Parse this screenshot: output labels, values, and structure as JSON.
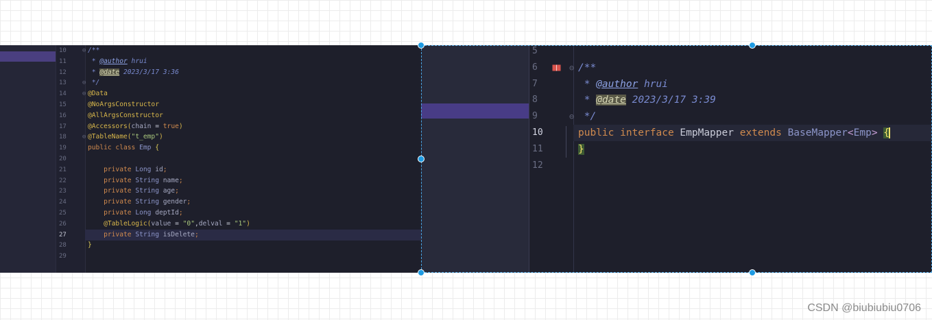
{
  "left_editor": {
    "lines": [
      {
        "n": "10",
        "fold": "⊖",
        "tokens": [
          {
            "c": "cm",
            "t": "/**"
          }
        ]
      },
      {
        "n": "11",
        "tokens": [
          {
            "c": "cm",
            "t": " * "
          },
          {
            "c": "tag",
            "t": "@author"
          },
          {
            "c": "cm",
            "t": " hrui"
          }
        ]
      },
      {
        "n": "12",
        "tokens": [
          {
            "c": "cm",
            "t": " * "
          },
          {
            "c": "tagbox",
            "t": "@date"
          },
          {
            "c": "cm",
            "t": " 2023/3/17 3:36"
          }
        ]
      },
      {
        "n": "13",
        "fold": "⊖",
        "tokens": [
          {
            "c": "cm",
            "t": " */"
          }
        ]
      },
      {
        "n": "14",
        "fold": "⊖",
        "tokens": [
          {
            "c": "ann",
            "t": "@Data"
          }
        ]
      },
      {
        "n": "15",
        "tokens": [
          {
            "c": "ann",
            "t": "@NoArgsConstructor"
          }
        ]
      },
      {
        "n": "16",
        "tokens": [
          {
            "c": "ann",
            "t": "@AllArgsConstructor"
          }
        ]
      },
      {
        "n": "17",
        "tokens": [
          {
            "c": "ann",
            "t": "@Accessors("
          },
          {
            "c": "id",
            "t": "chain"
          },
          {
            "c": "plain",
            "t": " = "
          },
          {
            "c": "kw",
            "t": "true"
          },
          {
            "c": "ann",
            "t": ")"
          }
        ]
      },
      {
        "n": "18",
        "fold": "⊖",
        "tokens": [
          {
            "c": "ann",
            "t": "@TableName("
          },
          {
            "c": "str",
            "t": "\"t_emp\""
          },
          {
            "c": "ann",
            "t": ")"
          }
        ]
      },
      {
        "n": "19",
        "tokens": [
          {
            "c": "kw",
            "t": "public class "
          },
          {
            "c": "ty",
            "t": "Emp"
          },
          {
            "c": "brace",
            "t": " {"
          }
        ]
      },
      {
        "n": "20",
        "tokens": []
      },
      {
        "n": "21",
        "tokens": [
          {
            "c": "kw",
            "t": "    private "
          },
          {
            "c": "ty",
            "t": "Long"
          },
          {
            "c": "id",
            "t": " id"
          },
          {
            "c": "kw",
            "t": ";"
          }
        ]
      },
      {
        "n": "22",
        "tokens": [
          {
            "c": "kw",
            "t": "    private "
          },
          {
            "c": "ty",
            "t": "String"
          },
          {
            "c": "id",
            "t": " name"
          },
          {
            "c": "kw",
            "t": ";"
          }
        ]
      },
      {
        "n": "23",
        "tokens": [
          {
            "c": "kw",
            "t": "    private "
          },
          {
            "c": "ty",
            "t": "String"
          },
          {
            "c": "id",
            "t": " age"
          },
          {
            "c": "kw",
            "t": ";"
          }
        ]
      },
      {
        "n": "24",
        "tokens": [
          {
            "c": "kw",
            "t": "    private "
          },
          {
            "c": "ty",
            "t": "String"
          },
          {
            "c": "id",
            "t": " gender"
          },
          {
            "c": "kw",
            "t": ";"
          }
        ]
      },
      {
        "n": "25",
        "tokens": [
          {
            "c": "kw",
            "t": "    private "
          },
          {
            "c": "ty",
            "t": "Long"
          },
          {
            "c": "id",
            "t": " deptId"
          },
          {
            "c": "kw",
            "t": ";"
          }
        ]
      },
      {
        "n": "26",
        "tokens": [
          {
            "c": "ann",
            "t": "    @TableLogic("
          },
          {
            "c": "id",
            "t": "value"
          },
          {
            "c": "plain",
            "t": " = "
          },
          {
            "c": "str",
            "t": "\"0\""
          },
          {
            "c": "plain",
            "t": ","
          },
          {
            "c": "id",
            "t": "delval"
          },
          {
            "c": "plain",
            "t": " = "
          },
          {
            "c": "str",
            "t": "\"1\""
          },
          {
            "c": "ann",
            "t": ")"
          }
        ]
      },
      {
        "n": "27",
        "current": true,
        "tokens": [
          {
            "c": "kw",
            "t": "    private "
          },
          {
            "c": "ty",
            "t": "String"
          },
          {
            "c": "id",
            "t": " isDelete"
          },
          {
            "c": "kw",
            "t": ";"
          }
        ]
      },
      {
        "n": "28",
        "tokens": [
          {
            "c": "brace",
            "t": "}"
          }
        ]
      },
      {
        "n": "29",
        "tokens": []
      }
    ]
  },
  "right_editor": {
    "lines": [
      {
        "n": "5",
        "tokens": []
      },
      {
        "n": "6",
        "fold": "⊖",
        "tokens": [
          {
            "c": "cm",
            "t": "/**"
          }
        ]
      },
      {
        "n": "7",
        "tokens": [
          {
            "c": "cm",
            "t": " * "
          },
          {
            "c": "tag",
            "t": "@author"
          },
          {
            "c": "cm",
            "t": " hrui"
          }
        ]
      },
      {
        "n": "8",
        "tokens": [
          {
            "c": "cm",
            "t": " * "
          },
          {
            "c": "tagbox",
            "t": "@date"
          },
          {
            "c": "cm",
            "t": " 2023/3/17 3:39"
          }
        ]
      },
      {
        "n": "9",
        "fold": "⊖",
        "tokens": [
          {
            "c": "cm",
            "t": " */"
          }
        ]
      },
      {
        "n": "10",
        "current": true,
        "tokens": [
          {
            "c": "kw",
            "t": "public interface "
          },
          {
            "c": "plain",
            "t": "EmpMapper "
          },
          {
            "c": "kw",
            "t": "extends "
          },
          {
            "c": "ty",
            "t": "BaseMapper"
          },
          {
            "c": "gen",
            "t": "<"
          },
          {
            "c": "ty",
            "t": "Emp"
          },
          {
            "c": "gen",
            "t": ">"
          },
          {
            "c": "plain",
            "t": " "
          },
          {
            "c": "braceb",
            "t": "{"
          }
        ]
      },
      {
        "n": "11",
        "tokens": [
          {
            "c": "braceb",
            "t": "}"
          }
        ]
      },
      {
        "n": "12",
        "tokens": []
      }
    ]
  },
  "colors": {
    "editor_bg": "#1e1f2b",
    "selection_frame": "#4aa8e8",
    "handle": "#1e9be3"
  },
  "watermark": {
    "text": "CSDN @biubiubiu0706"
  }
}
